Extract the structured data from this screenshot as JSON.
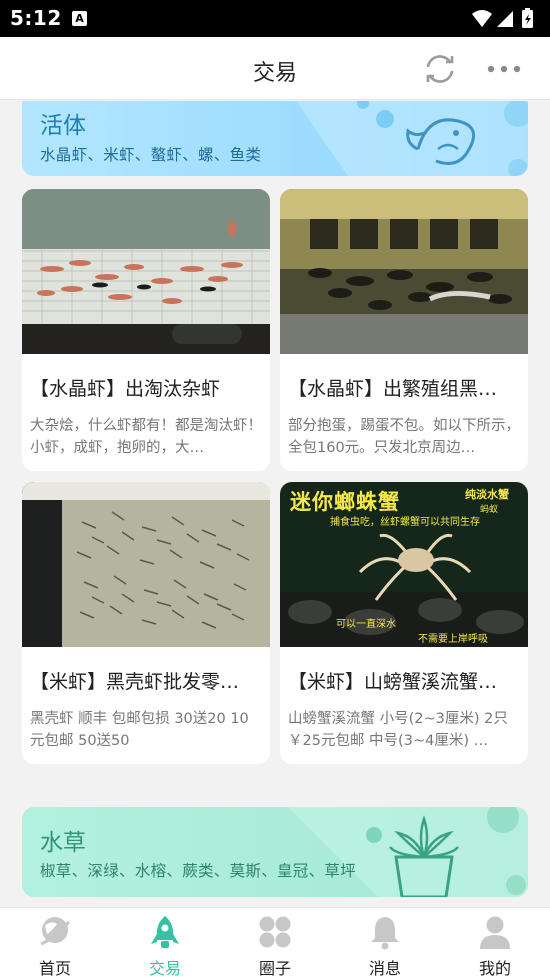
{
  "status_bar": {
    "time": "5:12",
    "notification_badge": "A"
  },
  "header": {
    "title": "交易"
  },
  "sections": {
    "live": {
      "title": "活体",
      "subtitle": "水晶虾、米虾、螯虾、螺、鱼类",
      "color": "#9edcff"
    },
    "plants": {
      "title": "水草",
      "subtitle": "椒草、深绿、水榕、蕨类、莫斯、皇冠、草坪",
      "color": "#a9ecd9"
    }
  },
  "cards": [
    {
      "title": "【水晶虾】出淘汰杂虾",
      "desc": "大杂烩，什么虾都有！都是淘汰虾！小虾，成虾，抱卵的，大…"
    },
    {
      "title": "【水晶虾】出繁殖组黑…",
      "desc": "部分抱蛋，踢蛋不包。如以下所示，全包160元。只发北京周边…"
    },
    {
      "title": "【米虾】黑壳虾批发零…",
      "desc": "黑壳虾 顺丰 包邮包损 30送20 10元包邮 50送50"
    },
    {
      "title": "【米虾】山螃蟹溪流蟹…",
      "desc": "山螃蟹溪流蟹 小号(2~3厘米) 2只 ￥25元包邮 中号(3~4厘米) …",
      "image_caption": {
        "main": "迷你螂蛛蟹",
        "corner": "纯淡水蟹",
        "corner_sub": "蚂蚁",
        "line1": "捕食虫吃，丝虾螺蟹可以共同生存",
        "line2": "可以一直深水",
        "line3": "不需要上岸呼吸"
      }
    }
  ],
  "nav": [
    {
      "label": "首页",
      "icon": "planet-icon",
      "active": false
    },
    {
      "label": "交易",
      "icon": "rocket-icon",
      "active": true
    },
    {
      "label": "圈子",
      "icon": "grid-circles-icon",
      "active": false
    },
    {
      "label": "消息",
      "icon": "bell-icon",
      "active": false
    },
    {
      "label": "我的",
      "icon": "user-icon",
      "active": false
    }
  ],
  "colors": {
    "accent": "#35c2a4",
    "inactive_icon": "#c7c7c7"
  }
}
